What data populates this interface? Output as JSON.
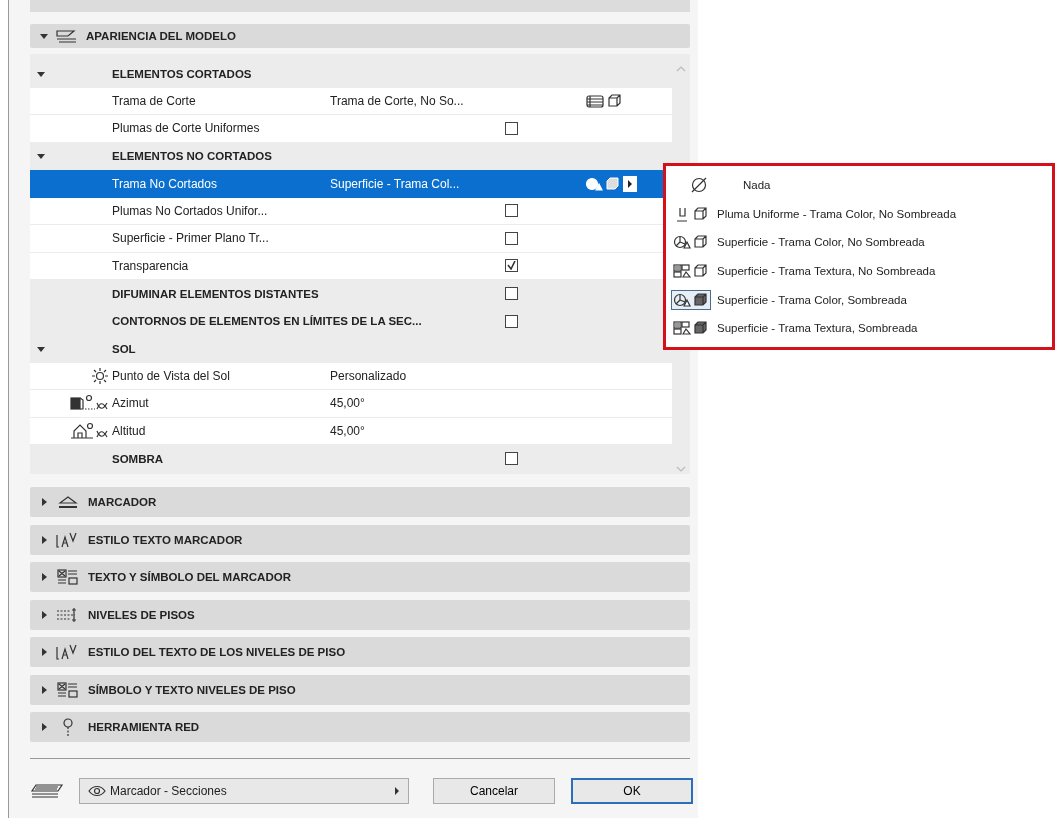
{
  "top_section": {
    "title": "APARIENCIA DEL MODELO",
    "expanded": true
  },
  "tree": [
    {
      "kind": "group",
      "name": "ELEMENTOS CORTADOS",
      "expanded": true,
      "selected": false
    },
    {
      "kind": "cut-pattern",
      "name": "Trama de Corte",
      "value": "Trama de Corte, No So...",
      "selected": false
    },
    {
      "kind": "check",
      "name": "Plumas de Corte Uniformes",
      "checked": false,
      "selected": false
    },
    {
      "kind": "group",
      "name": "ELEMENTOS NO CORTADOS",
      "expanded": true,
      "selected": false
    },
    {
      "kind": "surface-pattern",
      "name": "Trama No Cortados",
      "value": "Superficie - Trama Col...",
      "selected": true
    },
    {
      "kind": "check",
      "name": "Plumas No Cortados Unifor...",
      "checked": false,
      "selected": false
    },
    {
      "kind": "check",
      "name": "Superficie - Primer Plano Tr...",
      "checked": false,
      "selected": false
    },
    {
      "kind": "check",
      "name": "Transparencia",
      "checked": true,
      "selected": false
    },
    {
      "kind": "option",
      "name": "DIFUMINAR ELEMENTOS DISTANTES",
      "checked": false,
      "selected": false
    },
    {
      "kind": "option",
      "name": "CONTORNOS DE ELEMENTOS EN LÍMITES DE LA SEC...",
      "checked": false,
      "selected": false
    },
    {
      "kind": "group",
      "name": "SOL",
      "expanded": true,
      "selected": false
    },
    {
      "kind": "sun",
      "name": "Punto de Vista del Sol",
      "value": "Personalizado",
      "selected": false
    },
    {
      "kind": "azimuth",
      "name": "Azimut",
      "value": "45,00°",
      "selected": false
    },
    {
      "kind": "altitude",
      "name": "Altitud",
      "value": "45,00°",
      "selected": false
    },
    {
      "kind": "option",
      "name": "SOMBRA",
      "checked": false,
      "selected": false
    }
  ],
  "popup": {
    "items": [
      {
        "kind": "none",
        "label": "Nada",
        "selected": false
      },
      {
        "kind": "pen-flat",
        "label": "Pluma Uniforme - Trama Color, No Sombreada",
        "selected": false
      },
      {
        "kind": "color-flat",
        "label": "Superficie - Trama Color, No Sombreada",
        "selected": false
      },
      {
        "kind": "texture-flat",
        "label": "Superficie - Trama Textura, No Sombreada",
        "selected": false
      },
      {
        "kind": "color-shaded",
        "label": "Superficie - Trama Color, Sombreada",
        "selected": true
      },
      {
        "kind": "texture-shaded",
        "label": "Superficie - Trama Textura, Sombreada",
        "selected": false
      }
    ]
  },
  "sections": [
    {
      "kind": "marker",
      "title": "MARCADOR",
      "expanded": false
    },
    {
      "kind": "text-style",
      "title": "ESTILO TEXTO MARCADOR",
      "expanded": false
    },
    {
      "kind": "text-symbol",
      "title": "TEXTO Y SÍMBOLO DEL MARCADOR",
      "expanded": false
    },
    {
      "kind": "levels",
      "title": "NIVELES DE PISOS",
      "expanded": false
    },
    {
      "kind": "text-style",
      "title": "ESTILO DEL TEXTO DE LOS NIVELES DE PISO",
      "expanded": false
    },
    {
      "kind": "text-symbol",
      "title": "SÍMBOLO Y TEXTO NIVELES DE PISO",
      "expanded": false
    },
    {
      "kind": "grid",
      "title": "HERRAMIENTA RED",
      "expanded": false
    }
  ],
  "footer": {
    "favorite": "Marcador - Secciones",
    "buttons": [
      {
        "label": "Cancelar",
        "default": false
      },
      {
        "label": "OK",
        "default": true
      }
    ]
  }
}
